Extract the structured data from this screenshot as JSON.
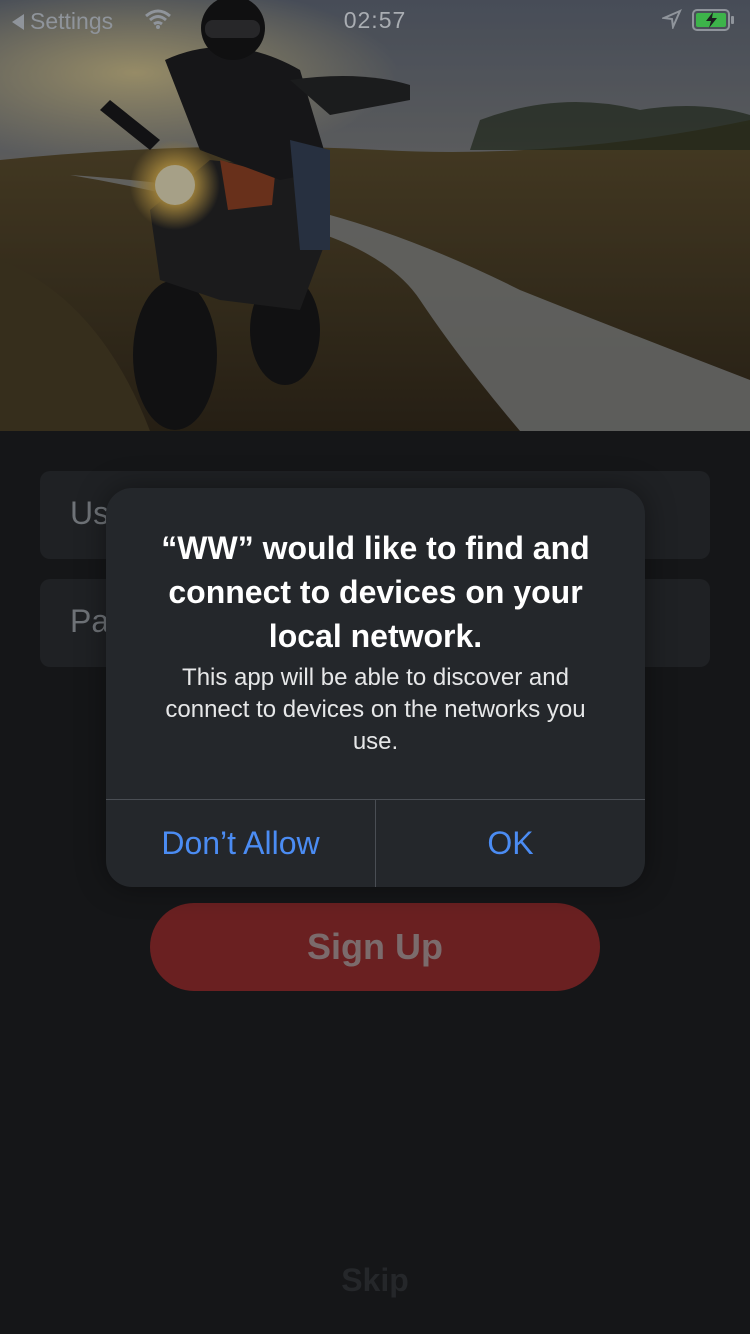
{
  "status_bar": {
    "back_label": "Settings",
    "time": "02:57"
  },
  "form": {
    "username_placeholder": "Username",
    "password_placeholder": "Password",
    "signup_label": "Sign Up",
    "skip_label": "Skip"
  },
  "dialog": {
    "title": "“WW” would like to find and connect to devices on your local network.",
    "message": "This app will be able to discover and connect to devices on the networks you use.",
    "deny_label": "Don’t Allow",
    "ok_label": "OK"
  },
  "colors": {
    "accent": "#4b8cf3",
    "signup_bg": "#6a2021",
    "background": "#151618"
  },
  "icons": {
    "back": "back-triangle-icon",
    "wifi": "wifi-icon",
    "location": "location-arrow-icon",
    "battery": "battery-charging-icon"
  }
}
